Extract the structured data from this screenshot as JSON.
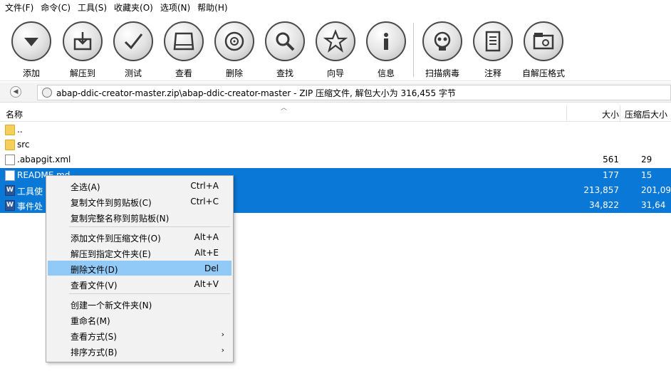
{
  "menubar": [
    "文件(F)",
    "命令(C)",
    "工具(S)",
    "收藏夹(O)",
    "选项(N)",
    "帮助(H)"
  ],
  "toolbar": {
    "buttons": [
      {
        "label": "添加",
        "icon": "add-icon"
      },
      {
        "label": "解压到",
        "icon": "extract-icon"
      },
      {
        "label": "测试",
        "icon": "test-icon"
      },
      {
        "label": "查看",
        "icon": "view-icon"
      },
      {
        "label": "删除",
        "icon": "delete-icon"
      },
      {
        "label": "查找",
        "icon": "find-icon"
      },
      {
        "label": "向导",
        "icon": "wizard-icon"
      },
      {
        "label": "信息",
        "icon": "info-icon"
      },
      {
        "label": "扫描病毒",
        "icon": "virus-scan-icon"
      },
      {
        "label": "注释",
        "icon": "comment-icon"
      },
      {
        "label": "自解压格式",
        "icon": "sfx-icon"
      }
    ]
  },
  "address": {
    "text": "abap-ddic-creator-master.zip\\abap-ddic-creator-master - ZIP 压缩文件, 解包大小为 316,455 字节"
  },
  "columns": {
    "name": "名称",
    "size": "大小",
    "packed": "压缩后大小"
  },
  "files": [
    {
      "name": "..",
      "size": "",
      "packed": "",
      "type": "folder",
      "selected": false
    },
    {
      "name": "src",
      "size": "",
      "packed": "",
      "type": "folder",
      "selected": false
    },
    {
      "name": ".abapgit.xml",
      "size": "561",
      "packed": "29",
      "type": "xml",
      "selected": false
    },
    {
      "name": "README.md",
      "size": "177",
      "packed": "15",
      "type": "md",
      "selected": true
    },
    {
      "name": "工具使",
      "size": "213,857",
      "packed": "201,09",
      "type": "doc",
      "selected": true
    },
    {
      "name": "事件处",
      "size": "34,822",
      "packed": "31,64",
      "type": "doc",
      "selected": true
    }
  ],
  "context_menu": {
    "groups": [
      [
        {
          "label": "全选(A)",
          "shortcut": "Ctrl+A"
        },
        {
          "label": "复制文件到剪贴板(C)",
          "shortcut": "Ctrl+C"
        },
        {
          "label": "复制完整名称到剪贴板(N)",
          "shortcut": ""
        }
      ],
      [
        {
          "label": "添加文件到压缩文件(O)",
          "shortcut": "Alt+A"
        },
        {
          "label": "解压到指定文件夹(E)",
          "shortcut": "Alt+E"
        },
        {
          "label": "删除文件(D)",
          "shortcut": "Del",
          "highlighted": true
        },
        {
          "label": "查看文件(V)",
          "shortcut": "Alt+V"
        }
      ],
      [
        {
          "label": "创建一个新文件夹(N)",
          "shortcut": ""
        },
        {
          "label": "重命名(M)",
          "shortcut": ""
        },
        {
          "label": "查看方式(S)",
          "shortcut": "",
          "submenu": true
        },
        {
          "label": "排序方式(B)",
          "shortcut": "",
          "submenu": true
        }
      ]
    ]
  }
}
